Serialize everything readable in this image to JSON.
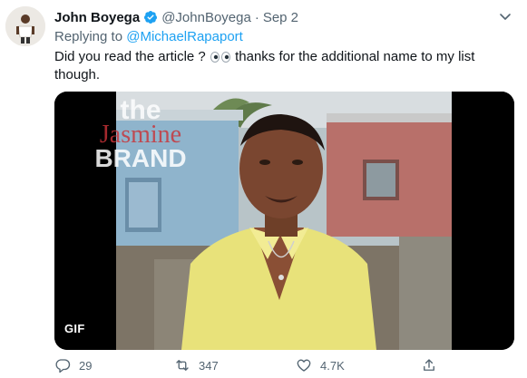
{
  "tweet": {
    "author_name": "John Boyega",
    "handle": "@JohnBoyega",
    "separator": "·",
    "date": "Sep 2",
    "replying_prefix": "Replying to",
    "replying_to": "@MichaelRapaport",
    "text_before_emoji": "Did you read the article ?",
    "emoji": "eyes-emoji",
    "text_after_emoji": "thanks for the additional name to my list though.",
    "media": {
      "watermark_line1": "the",
      "watermark_line2": "Jasmine",
      "watermark_line3": "BRAND",
      "gif_badge": "GIF"
    },
    "actions": {
      "replies": "29",
      "retweets": "347",
      "likes": "4.7K"
    }
  },
  "colors": {
    "accent": "#1da1f2",
    "secondary_text": "#536471",
    "watermark_red": "#c0392b"
  }
}
